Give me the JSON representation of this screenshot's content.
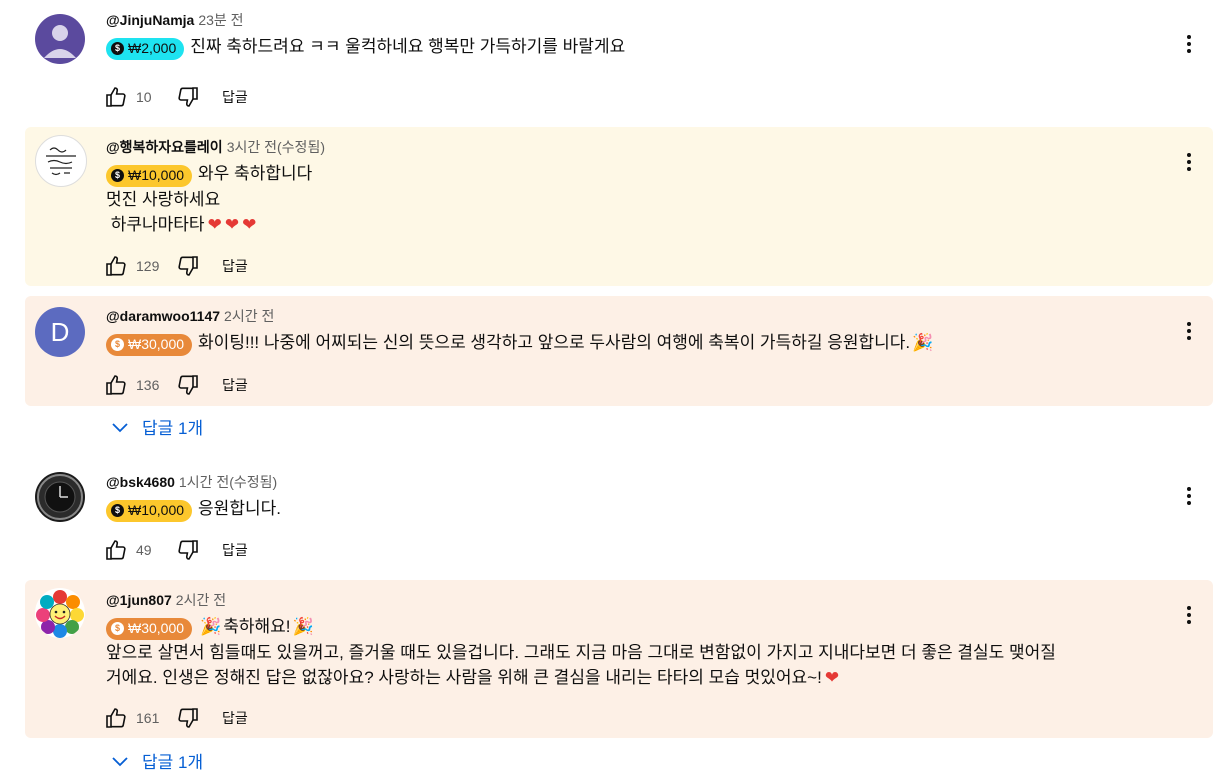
{
  "comments": [
    {
      "author": "@JinjuNamja",
      "time": "23분 전",
      "chip": "₩2,000",
      "chip_color": "#1ee3f0",
      "lines": [
        "진짜 축하드려요 ㅋㅋ 울컥하네요 행복만 가득하기를 바랄게요"
      ],
      "likes": "10",
      "reply_label": "답글",
      "bg": "#ffffff"
    },
    {
      "author": "@행복하자요를레이",
      "time": "3시간 전(수정됨)",
      "chip": "₩10,000",
      "chip_color": "#fcc72c",
      "line1": "와우 축하합니다",
      "line2": "멋진 사랑하세요",
      "line3": " 하쿠나마타타",
      "likes": "129",
      "reply_label": "답글",
      "bg": "#fef8e6"
    },
    {
      "author": "@daramwoo1147",
      "time": "2시간 전",
      "chip": "₩30,000",
      "chip_color": "#e8893a",
      "line1": "화이팅!!! 나중에 어찌되는 신의 뜻으로 생각하고 앞으로 두사람의 여행에 축복이 가득하길 응원합니다.",
      "likes": "136",
      "reply_label": "답글",
      "bg": "#fdf0e6",
      "avatar_letter": "D"
    },
    {
      "author": "@bsk4680",
      "time": "1시간 전(수정됨)",
      "chip": "₩10,000",
      "chip_color": "#fcc72c",
      "line1": "응원합니다.",
      "likes": "49",
      "reply_label": "답글",
      "bg": "#ffffff"
    },
    {
      "author": "@1jun807",
      "time": "2시간 전",
      "chip": "₩30,000",
      "chip_color": "#e8893a",
      "line1": "축하해요!",
      "line2": "앞으로 살면서 힘들때도 있을꺼고, 즐거울 때도 있을겁니다. 그래도 지금 마음 그대로 변함없이 가지고 지내다보면 더 좋은 결실도 맺어질",
      "line3": "거에요. 인생은 정해진 답은 없잖아요? 사랑하는 사람을 위해 큰 결심을 내리는 타타의 모습 멋있어요~!",
      "likes": "161",
      "reply_label": "답글",
      "bg": "#fdf0e6"
    }
  ],
  "replies_toggle": [
    "답글 1개",
    "답글 1개"
  ],
  "emoji": {
    "heart": "❤",
    "party": "🎉"
  },
  "colors": {
    "link": "#065fd4",
    "meta": "#606060"
  },
  "icons": [
    "like-icon",
    "dislike-icon",
    "more-vert-icon",
    "chevron-down-icon"
  ]
}
